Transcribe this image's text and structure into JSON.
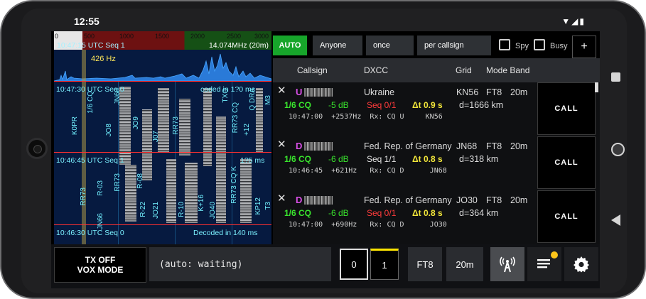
{
  "status_bar": {
    "time": "12:55",
    "icons": [
      "wifi-icon",
      "signal-icon",
      "battery-icon"
    ]
  },
  "waterfall": {
    "scale_ticks": [
      "0",
      "500",
      "1000",
      "1500",
      "2000",
      "2500",
      "3000"
    ],
    "top_seq": "10:47:15 UTC Seq 1",
    "frequency": "14.074MHz (20m)",
    "cursor_hz": "426 Hz",
    "line1": "10:47:30 UTC Seq 0",
    "line1_right": "coded in 1?0 ms",
    "line2": "10:46:45 UTC Seq 1",
    "line2_right": "1?5 ms",
    "line3": "10:46:30 UTC Seq 0",
    "line3_right": "Decoded in 140 ms",
    "vertical_labels": [
      "K0PR",
      "R-03",
      "JO8",
      "R-08",
      "J07",
      "RR73",
      "K+16",
      "JO21",
      "R-10",
      "JO40",
      "KP12",
      "T3",
      "1/6 CQ",
      "JN66",
      "+12",
      "Q DRA",
      "RR73",
      "JN68",
      "R-22",
      "RR73 CQ",
      "RR73 CQ K",
      "JO9",
      "RR73",
      "M3",
      "TXO"
    ]
  },
  "toolbar": {
    "auto_label": "AUTO",
    "filter_label": "Anyone",
    "repeat_label": "once",
    "mode_label": "per callsign",
    "spy_label": "Spy",
    "busy_label": "Busy",
    "add_label": "+"
  },
  "columns": {
    "callsign": "Callsign",
    "dxcc": "DXCC",
    "grid": "Grid",
    "mode_band": "Mode Band"
  },
  "rows": [
    {
      "prefix": "U",
      "dxcc": "Ukraine",
      "grid": "KN56",
      "mode": "FT8",
      "band": "20m",
      "cq": "1/6 CQ",
      "snr": "-5 dB",
      "seq": "Seq 0/1",
      "seq_color": "#ff3b3b",
      "dt": "Δt 0.9 s",
      "dist": "d=1666 km",
      "meta": "10:47:00  +2537Hz  Rx: CQ U     KN56",
      "call_label": "CALL"
    },
    {
      "prefix": "D",
      "dxcc": "Fed. Rep. of Germany",
      "grid": "JN68",
      "mode": "FT8",
      "band": "20m",
      "cq": "1/6 CQ",
      "snr": "-6 dB",
      "seq": "Seq 1/1",
      "seq_color": "#e5e5e5",
      "dt": "Δt 0.8 s",
      "dist": "d=318 km",
      "meta": "10:46:45  +621Hz   Rx: CQ D      JN68",
      "call_label": "CALL"
    },
    {
      "prefix": "D",
      "dxcc": "Fed. Rep. of Germany",
      "grid": "JO30",
      "mode": "FT8",
      "band": "20m",
      "cq": "1/6 CQ",
      "snr": "-6 dB",
      "seq": "Seq 0/1",
      "seq_color": "#ff3b3b",
      "dt": "Δt 0.8 s",
      "dist": "d=364 km",
      "meta": "10:47:00  +690Hz   Rx: CQ D      JO30",
      "call_label": "CALL"
    }
  ],
  "bottom": {
    "tx_line1": "TX OFF",
    "tx_line2": "VOX MODE",
    "status_text": "(auto: waiting)",
    "slot0": "0",
    "slot1": "1",
    "mode": "FT8",
    "band": "20m",
    "icons": [
      "antenna-icon",
      "log-list-icon",
      "settings-gear-icon"
    ],
    "accent": "#ffe600"
  }
}
